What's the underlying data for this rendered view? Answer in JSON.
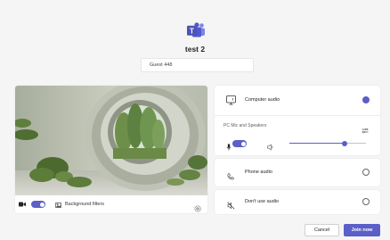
{
  "meeting": {
    "title": "test 2",
    "name_input_value": "Guest 448",
    "brand_color": "#5b5fc7"
  },
  "video": {
    "camera_on": true,
    "background_filters_label": "Background filters"
  },
  "audio_options": {
    "computer_audio": {
      "label": "Computer audio",
      "selected": true
    },
    "device_label": "PC Mic and Speakers",
    "mic_on": true,
    "speaker_volume": 0.72,
    "phone_audio": {
      "label": "Phone audio",
      "selected": false
    },
    "no_audio": {
      "label": "Don't use audio",
      "selected": false
    }
  },
  "actions": {
    "cancel_label": "Cancel",
    "join_label": "Join now"
  },
  "icons": [
    "teams-logo-icon",
    "camera-icon",
    "background-filters-icon",
    "settings-icon",
    "computer-audio-icon",
    "device-settings-icon",
    "mic-icon",
    "speaker-icon",
    "phone-icon",
    "no-audio-icon"
  ]
}
